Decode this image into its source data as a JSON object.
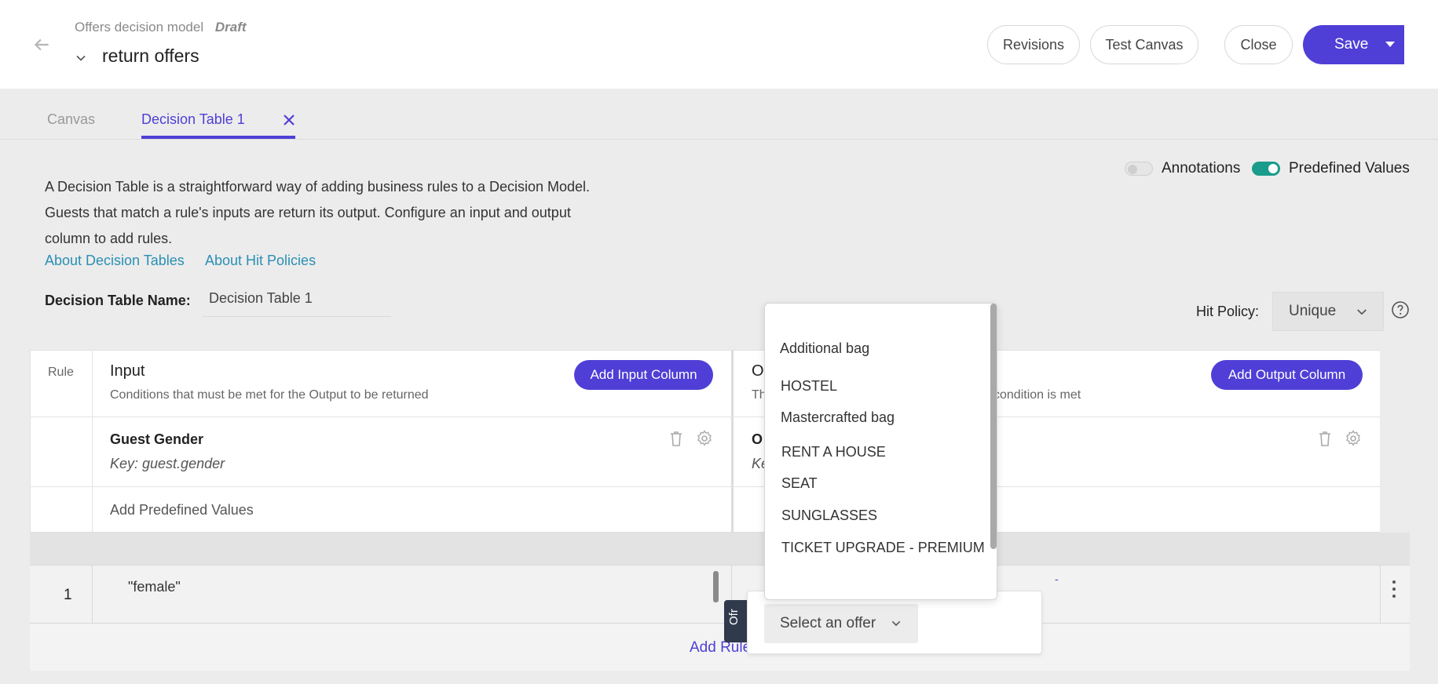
{
  "header": {
    "breadcrumb": "Offers decision model",
    "status": "Draft",
    "title": "return offers",
    "buttons": {
      "revisions": "Revisions",
      "test_canvas": "Test Canvas",
      "close": "Close",
      "save": "Save"
    }
  },
  "tabs": [
    {
      "label": "Canvas",
      "active": false
    },
    {
      "label": "Decision Table 1",
      "active": true
    }
  ],
  "toggles": {
    "annotations": {
      "label": "Annotations",
      "on": false
    },
    "predefined": {
      "label": "Predefined Values",
      "on": true
    }
  },
  "description": "A Decision Table is a straightforward way of adding business rules to a Decision Model. Guests that match a rule's inputs are return its output. Configure an input and output column to add rules.",
  "links": {
    "about_tables": "About Decision Tables",
    "about_policies": "About Hit Policies"
  },
  "table_name": {
    "label": "Decision Table Name:",
    "value": "Decision Table 1"
  },
  "hit_policy": {
    "label": "Hit Policy:",
    "value": "Unique"
  },
  "table": {
    "rule_header": "Rule",
    "input": {
      "title": "Input",
      "subtitle": "Conditions that must be met for the Output to be returned",
      "add_button": "Add Input Column",
      "column_name": "Guest Gender",
      "column_key": "Key: guest.gender",
      "add_predefined": "Add Predefined Values"
    },
    "output": {
      "title_partial": "O",
      "subtitle_partial_start": "Th",
      "subtitle_partial_end": "condition is met",
      "add_button": "Add Output Column",
      "column_name_partial": "O",
      "column_key_partial": "Ke"
    },
    "rows": [
      {
        "number": "1",
        "input_value": "\"female\"",
        "output_value": "-"
      }
    ],
    "add_rule": "Add Rule"
  },
  "offer_dropdown": {
    "options": [
      "Additional bag",
      "HOSTEL",
      "Mastercrafted bag",
      "RENT A HOUSE",
      "SEAT",
      "SUNGLASSES",
      "TICKET UPGRADE - PREMIUM"
    ],
    "select_placeholder": "Select an offer",
    "side_tab": "Ofr"
  },
  "colors": {
    "accent": "#4f3fd6",
    "toggle_on": "#1a9c8c",
    "link": "#2a8fb3"
  }
}
